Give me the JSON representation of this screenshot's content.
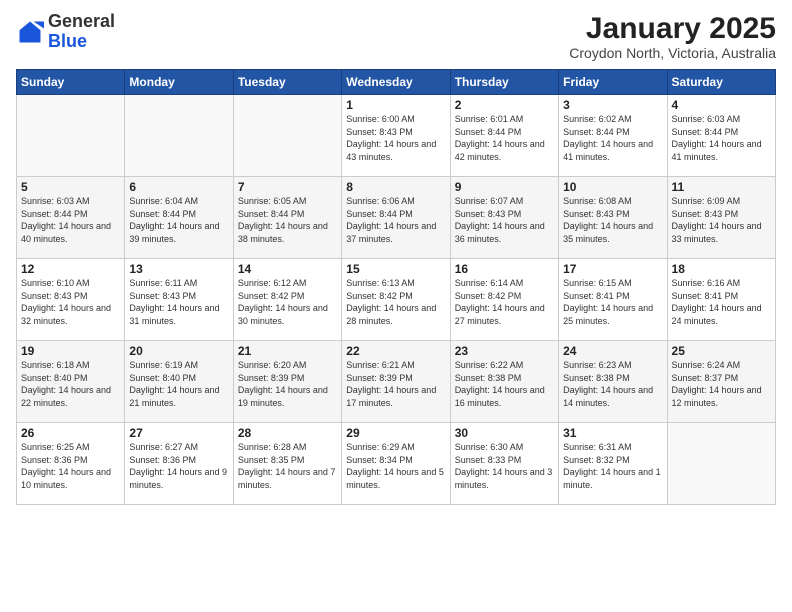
{
  "logo": {
    "general": "General",
    "blue": "Blue"
  },
  "header": {
    "month": "January 2025",
    "location": "Croydon North, Victoria, Australia"
  },
  "weekdays": [
    "Sunday",
    "Monday",
    "Tuesday",
    "Wednesday",
    "Thursday",
    "Friday",
    "Saturday"
  ],
  "weeks": [
    [
      {
        "day": "",
        "sunrise": "",
        "sunset": "",
        "daylight": ""
      },
      {
        "day": "",
        "sunrise": "",
        "sunset": "",
        "daylight": ""
      },
      {
        "day": "",
        "sunrise": "",
        "sunset": "",
        "daylight": ""
      },
      {
        "day": "1",
        "sunrise": "Sunrise: 6:00 AM",
        "sunset": "Sunset: 8:43 PM",
        "daylight": "Daylight: 14 hours and 43 minutes."
      },
      {
        "day": "2",
        "sunrise": "Sunrise: 6:01 AM",
        "sunset": "Sunset: 8:44 PM",
        "daylight": "Daylight: 14 hours and 42 minutes."
      },
      {
        "day": "3",
        "sunrise": "Sunrise: 6:02 AM",
        "sunset": "Sunset: 8:44 PM",
        "daylight": "Daylight: 14 hours and 41 minutes."
      },
      {
        "day": "4",
        "sunrise": "Sunrise: 6:03 AM",
        "sunset": "Sunset: 8:44 PM",
        "daylight": "Daylight: 14 hours and 41 minutes."
      }
    ],
    [
      {
        "day": "5",
        "sunrise": "Sunrise: 6:03 AM",
        "sunset": "Sunset: 8:44 PM",
        "daylight": "Daylight: 14 hours and 40 minutes."
      },
      {
        "day": "6",
        "sunrise": "Sunrise: 6:04 AM",
        "sunset": "Sunset: 8:44 PM",
        "daylight": "Daylight: 14 hours and 39 minutes."
      },
      {
        "day": "7",
        "sunrise": "Sunrise: 6:05 AM",
        "sunset": "Sunset: 8:44 PM",
        "daylight": "Daylight: 14 hours and 38 minutes."
      },
      {
        "day": "8",
        "sunrise": "Sunrise: 6:06 AM",
        "sunset": "Sunset: 8:44 PM",
        "daylight": "Daylight: 14 hours and 37 minutes."
      },
      {
        "day": "9",
        "sunrise": "Sunrise: 6:07 AM",
        "sunset": "Sunset: 8:43 PM",
        "daylight": "Daylight: 14 hours and 36 minutes."
      },
      {
        "day": "10",
        "sunrise": "Sunrise: 6:08 AM",
        "sunset": "Sunset: 8:43 PM",
        "daylight": "Daylight: 14 hours and 35 minutes."
      },
      {
        "day": "11",
        "sunrise": "Sunrise: 6:09 AM",
        "sunset": "Sunset: 8:43 PM",
        "daylight": "Daylight: 14 hours and 33 minutes."
      }
    ],
    [
      {
        "day": "12",
        "sunrise": "Sunrise: 6:10 AM",
        "sunset": "Sunset: 8:43 PM",
        "daylight": "Daylight: 14 hours and 32 minutes."
      },
      {
        "day": "13",
        "sunrise": "Sunrise: 6:11 AM",
        "sunset": "Sunset: 8:43 PM",
        "daylight": "Daylight: 14 hours and 31 minutes."
      },
      {
        "day": "14",
        "sunrise": "Sunrise: 6:12 AM",
        "sunset": "Sunset: 8:42 PM",
        "daylight": "Daylight: 14 hours and 30 minutes."
      },
      {
        "day": "15",
        "sunrise": "Sunrise: 6:13 AM",
        "sunset": "Sunset: 8:42 PM",
        "daylight": "Daylight: 14 hours and 28 minutes."
      },
      {
        "day": "16",
        "sunrise": "Sunrise: 6:14 AM",
        "sunset": "Sunset: 8:42 PM",
        "daylight": "Daylight: 14 hours and 27 minutes."
      },
      {
        "day": "17",
        "sunrise": "Sunrise: 6:15 AM",
        "sunset": "Sunset: 8:41 PM",
        "daylight": "Daylight: 14 hours and 25 minutes."
      },
      {
        "day": "18",
        "sunrise": "Sunrise: 6:16 AM",
        "sunset": "Sunset: 8:41 PM",
        "daylight": "Daylight: 14 hours and 24 minutes."
      }
    ],
    [
      {
        "day": "19",
        "sunrise": "Sunrise: 6:18 AM",
        "sunset": "Sunset: 8:40 PM",
        "daylight": "Daylight: 14 hours and 22 minutes."
      },
      {
        "day": "20",
        "sunrise": "Sunrise: 6:19 AM",
        "sunset": "Sunset: 8:40 PM",
        "daylight": "Daylight: 14 hours and 21 minutes."
      },
      {
        "day": "21",
        "sunrise": "Sunrise: 6:20 AM",
        "sunset": "Sunset: 8:39 PM",
        "daylight": "Daylight: 14 hours and 19 minutes."
      },
      {
        "day": "22",
        "sunrise": "Sunrise: 6:21 AM",
        "sunset": "Sunset: 8:39 PM",
        "daylight": "Daylight: 14 hours and 17 minutes."
      },
      {
        "day": "23",
        "sunrise": "Sunrise: 6:22 AM",
        "sunset": "Sunset: 8:38 PM",
        "daylight": "Daylight: 14 hours and 16 minutes."
      },
      {
        "day": "24",
        "sunrise": "Sunrise: 6:23 AM",
        "sunset": "Sunset: 8:38 PM",
        "daylight": "Daylight: 14 hours and 14 minutes."
      },
      {
        "day": "25",
        "sunrise": "Sunrise: 6:24 AM",
        "sunset": "Sunset: 8:37 PM",
        "daylight": "Daylight: 14 hours and 12 minutes."
      }
    ],
    [
      {
        "day": "26",
        "sunrise": "Sunrise: 6:25 AM",
        "sunset": "Sunset: 8:36 PM",
        "daylight": "Daylight: 14 hours and 10 minutes."
      },
      {
        "day": "27",
        "sunrise": "Sunrise: 6:27 AM",
        "sunset": "Sunset: 8:36 PM",
        "daylight": "Daylight: 14 hours and 9 minutes."
      },
      {
        "day": "28",
        "sunrise": "Sunrise: 6:28 AM",
        "sunset": "Sunset: 8:35 PM",
        "daylight": "Daylight: 14 hours and 7 minutes."
      },
      {
        "day": "29",
        "sunrise": "Sunrise: 6:29 AM",
        "sunset": "Sunset: 8:34 PM",
        "daylight": "Daylight: 14 hours and 5 minutes."
      },
      {
        "day": "30",
        "sunrise": "Sunrise: 6:30 AM",
        "sunset": "Sunset: 8:33 PM",
        "daylight": "Daylight: 14 hours and 3 minutes."
      },
      {
        "day": "31",
        "sunrise": "Sunrise: 6:31 AM",
        "sunset": "Sunset: 8:32 PM",
        "daylight": "Daylight: 14 hours and 1 minute."
      },
      {
        "day": "",
        "sunrise": "",
        "sunset": "",
        "daylight": ""
      }
    ]
  ]
}
